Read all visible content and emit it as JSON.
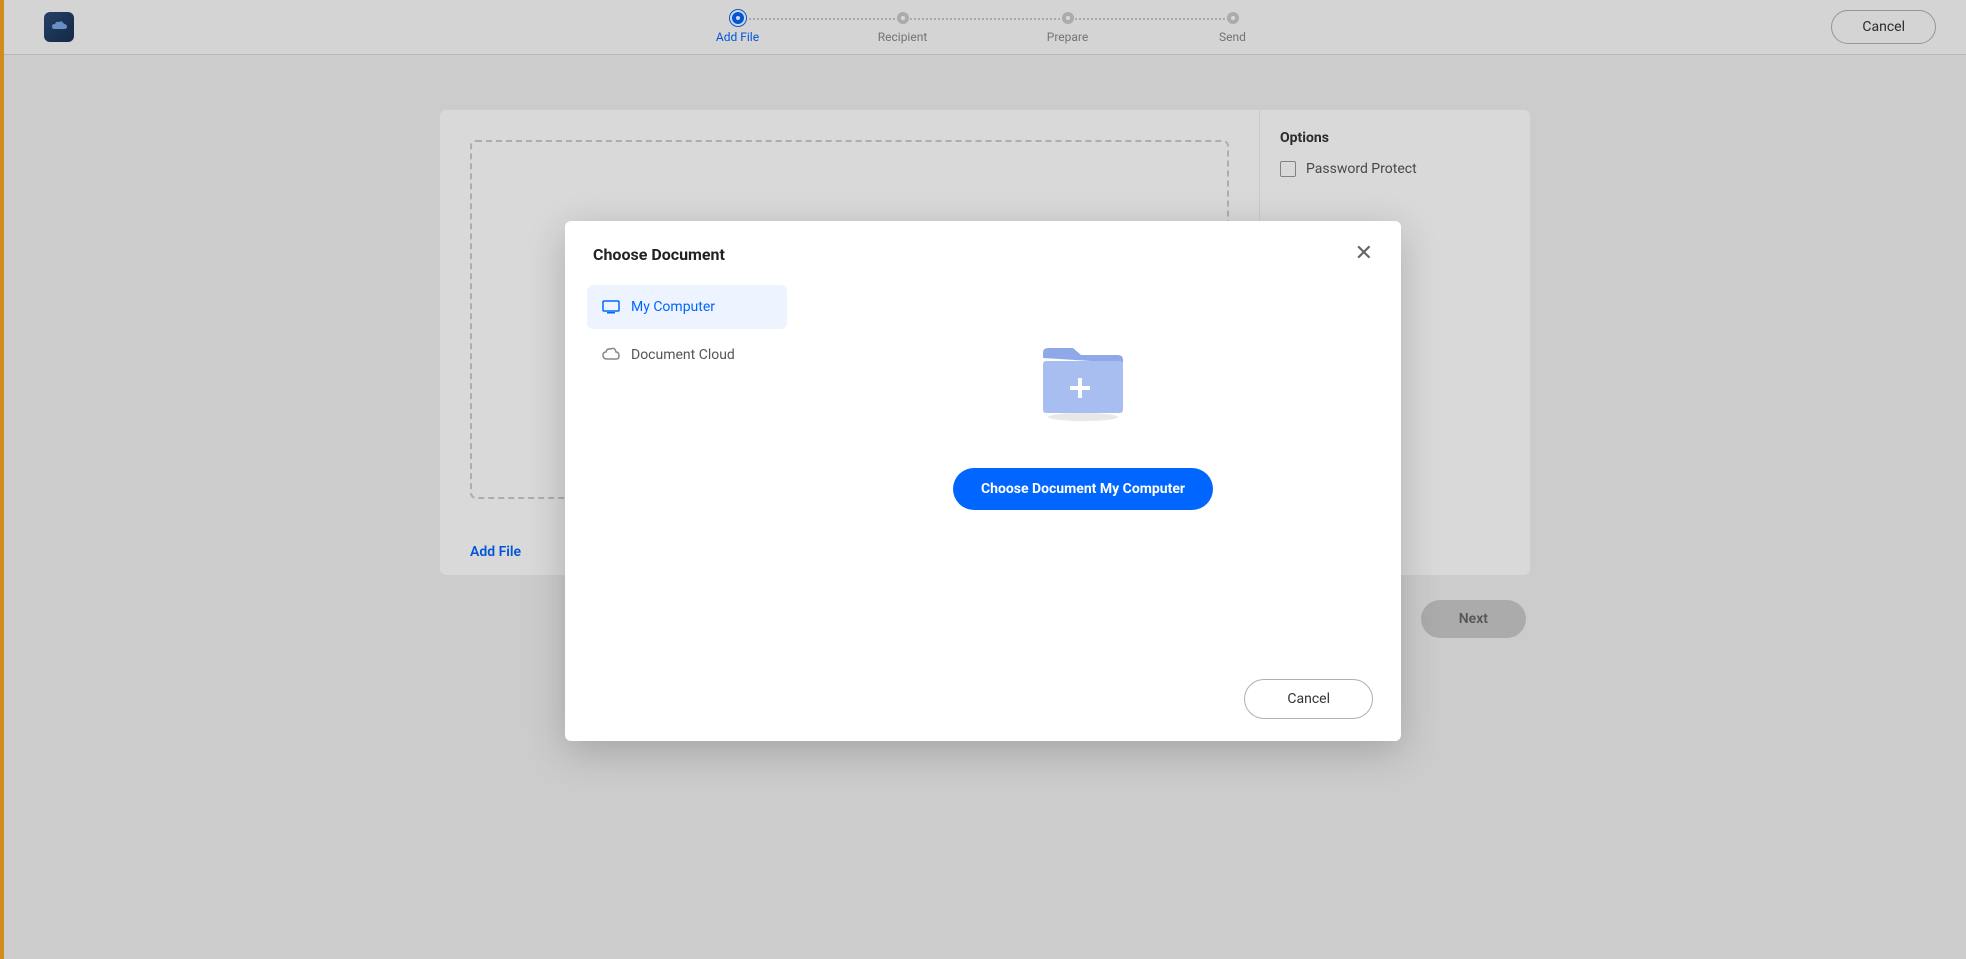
{
  "steps": {
    "s1": "Add File",
    "s2": "Recipient",
    "s3": "Prepare",
    "s4": "Send"
  },
  "topbar": {
    "cancel": "Cancel"
  },
  "main": {
    "addFile": "Add File",
    "options": "Options",
    "passwordProtect": "Password Protect",
    "next": "Next"
  },
  "modal": {
    "title": "Choose Document",
    "sourceMyComputer": "My Computer",
    "sourceDocCloud": "Document Cloud",
    "chooseBtn": "Choose Document My Computer",
    "cancel": "Cancel"
  }
}
